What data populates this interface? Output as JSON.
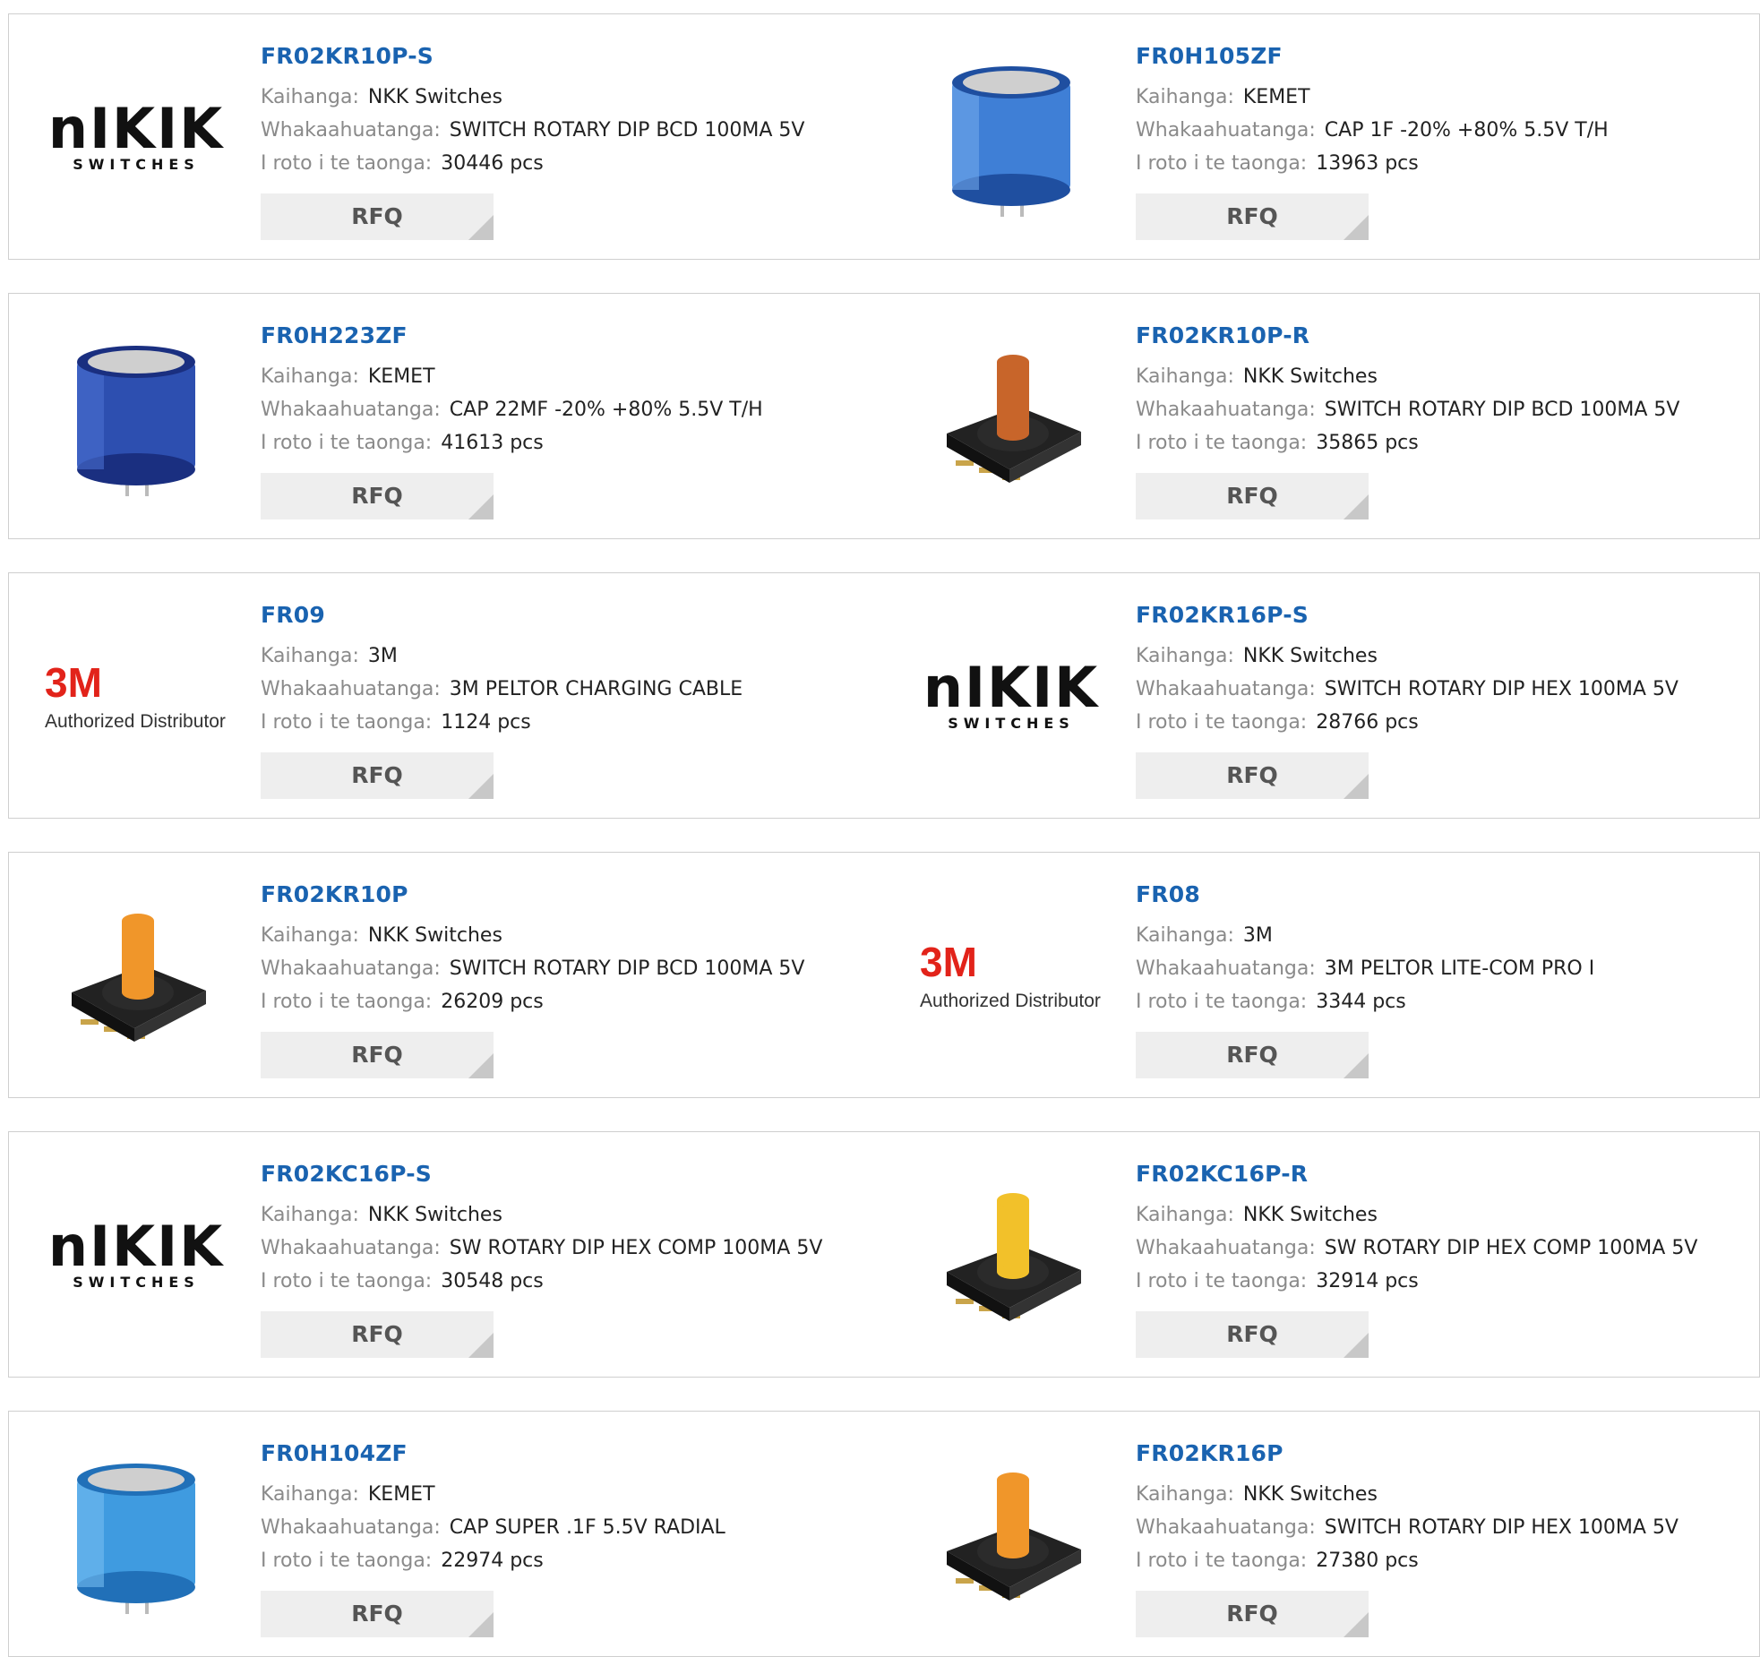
{
  "labels": {
    "manufacturer": "Kaihanga:",
    "description": "Whakaahuatanga:",
    "stock": "I roto i te taonga:",
    "rfq": "RFQ"
  },
  "logos": {
    "nkk_main": "nIKIK",
    "nkk_sub": "SWITCHES",
    "threem_main": "3M",
    "threem_sub": "Authorized Distributor"
  },
  "colors": {
    "link": "#1a63b0",
    "label": "#8a8a8a",
    "value": "#222222",
    "border": "#cfcfcf",
    "rfq_bg": "#eeeeee",
    "threem_red": "#e2231a"
  },
  "products": [
    {
      "part": "FR02KR10P-S",
      "manufacturer": "NKK Switches",
      "description": "SWITCH ROTARY DIP BCD 100MA 5V",
      "stock": "30446 pcs",
      "image": "nkk-logo"
    },
    {
      "part": "FR0H105ZF",
      "manufacturer": "KEMET",
      "description": "CAP 1F -20% +80% 5.5V T/H",
      "stock": "13963 pcs",
      "image": "capacitor-light"
    },
    {
      "part": "FR0H223ZF",
      "manufacturer": "KEMET",
      "description": "CAP 22MF -20% +80% 5.5V T/H",
      "stock": "41613 pcs",
      "image": "capacitor-dark"
    },
    {
      "part": "FR02KR10P-R",
      "manufacturer": "NKK Switches",
      "description": "SWITCH ROTARY DIP BCD 100MA 5V",
      "stock": "35865 pcs",
      "image": "rotary-brown"
    },
    {
      "part": "FR09",
      "manufacturer": "3M",
      "description": "3M PELTOR CHARGING CABLE",
      "stock": "1124 pcs",
      "image": "3m-logo"
    },
    {
      "part": "FR02KR16P-S",
      "manufacturer": "NKK Switches",
      "description": "SWITCH ROTARY DIP HEX 100MA 5V",
      "stock": "28766 pcs",
      "image": "nkk-logo"
    },
    {
      "part": "FR02KR10P",
      "manufacturer": "NKK Switches",
      "description": "SWITCH ROTARY DIP BCD 100MA 5V",
      "stock": "26209 pcs",
      "image": "rotary-orange"
    },
    {
      "part": "FR08",
      "manufacturer": "3M",
      "description": "3M PELTOR LITE-COM PRO I",
      "stock": "3344 pcs",
      "image": "3m-logo"
    },
    {
      "part": "FR02KC16P-S",
      "manufacturer": "NKK Switches",
      "description": "SW ROTARY DIP HEX COMP 100MA 5V",
      "stock": "30548 pcs",
      "image": "nkk-logo"
    },
    {
      "part": "FR02KC16P-R",
      "manufacturer": "NKK Switches",
      "description": "SW ROTARY DIP HEX COMP 100MA 5V",
      "stock": "32914 pcs",
      "image": "rotary-yellow"
    },
    {
      "part": "FR0H104ZF",
      "manufacturer": "KEMET",
      "description": "CAP SUPER .1F 5.5V RADIAL",
      "stock": "22974 pcs",
      "image": "capacitor-sky"
    },
    {
      "part": "FR02KR16P",
      "manufacturer": "NKK Switches",
      "description": "SWITCH ROTARY DIP HEX 100MA 5V",
      "stock": "27380 pcs",
      "image": "rotary-orange"
    }
  ]
}
